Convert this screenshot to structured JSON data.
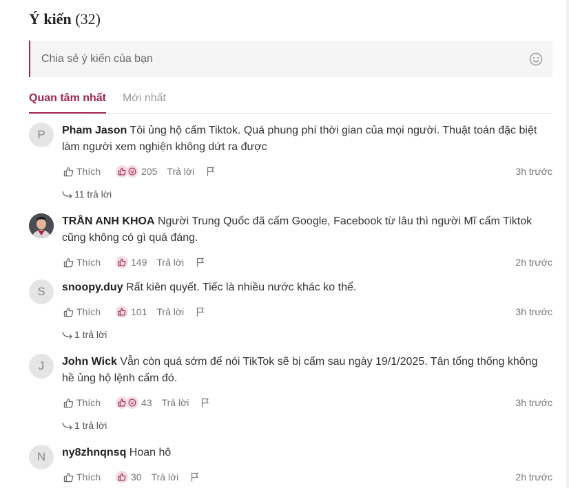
{
  "header": {
    "title": "Ý kiến",
    "count": "(32)"
  },
  "comment_box": {
    "placeholder": "Chia sẻ ý kiến của bạn"
  },
  "tabs": [
    {
      "label": "Quan tâm nhất"
    },
    {
      "label": "Mới nhất"
    }
  ],
  "colors": {
    "accent": "#9f224e",
    "muted": "#757575"
  },
  "comments": [
    {
      "avatar_letter": "P",
      "name": "Pham Jason",
      "text": "Tôi ủng hộ cấm Tiktok. Quá phung phí thời gian của mọi người. Thuật toán đặc biệt làm người xem nghiện không dứt ra được",
      "like_label": "Thích",
      "reaction_count": "205",
      "reply_label": "Trả lời",
      "time": "3h trước",
      "replies": "11 trả lời"
    },
    {
      "avatar_letter": "",
      "name": "TRẦN ANH KHOA",
      "text": "Người Trung Quốc đã cấm Google, Facebook từ lâu thì người Mĩ cấm Tiktok cũng không có gì quá đáng.",
      "like_label": "Thích",
      "reaction_count": "149",
      "reply_label": "Trả lời",
      "time": "2h trước"
    },
    {
      "avatar_letter": "S",
      "name": "snoopy.duy",
      "text": "Rất kiên quyết. Tiếc là nhiều nước khác ko thể.",
      "like_label": "Thích",
      "reaction_count": "101",
      "reply_label": "Trả lời",
      "time": "3h trước",
      "replies": "1 trả lời"
    },
    {
      "avatar_letter": "J",
      "name": "John Wick",
      "text": "Vẫn còn quá sớm để nói TikTok sẽ bị cấm sau ngày 19/1/2025. Tân tổng thống không hề ủng hộ lệnh cấm đó.",
      "like_label": "Thích",
      "reaction_count": "43",
      "reply_label": "Trả lời",
      "time": "3h trước",
      "replies": "1 trả lời"
    },
    {
      "avatar_letter": "N",
      "name": "ny8zhnqnsq",
      "text": "Hoan hô",
      "like_label": "Thích",
      "reaction_count": "30",
      "reply_label": "Trả lời",
      "time": "2h trước"
    }
  ]
}
